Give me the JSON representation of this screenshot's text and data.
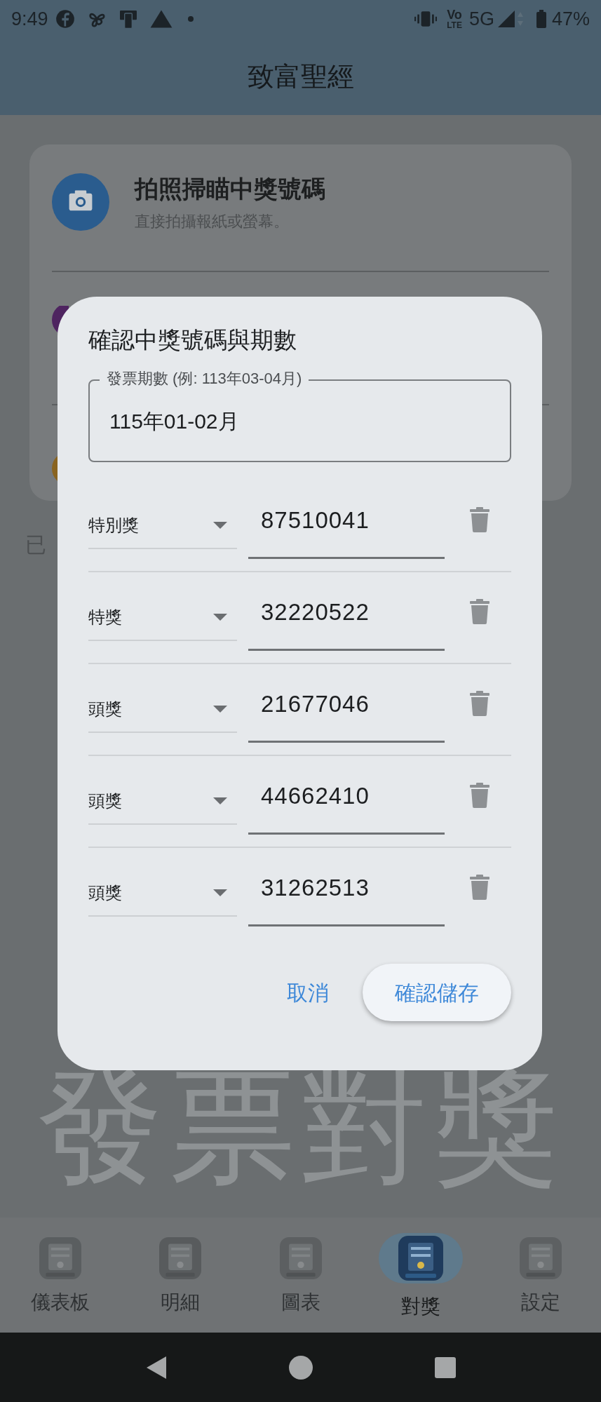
{
  "status_bar": {
    "time": "9:49",
    "volte": [
      "Vo",
      "LTE"
    ],
    "network": "5G",
    "battery": "47%"
  },
  "app_bar": {
    "title": "致富聖經"
  },
  "background": {
    "option": {
      "title": "拍照掃瞄中獎號碼",
      "subtitle": "直接拍攝報紙或螢幕。"
    },
    "partial_label": "已",
    "banner": "發票對獎"
  },
  "dialog": {
    "title": "確認中獎號碼與期數",
    "period_field": {
      "label": "發票期數 (例: 113年03-04月)",
      "value": "115年01-02月"
    },
    "prizes": [
      {
        "type": "特別獎",
        "number": "87510041"
      },
      {
        "type": "特獎",
        "number": "32220522"
      },
      {
        "type": "頭獎",
        "number": "21677046"
      },
      {
        "type": "頭獎",
        "number": "44662410"
      },
      {
        "type": "頭獎",
        "number": "31262513"
      }
    ],
    "buttons": [
      {
        "label": "取消",
        "kind": "text"
      },
      {
        "label": "確認儲存",
        "kind": "filled"
      }
    ]
  },
  "bottom_nav": [
    {
      "label": "儀表板",
      "selected": false
    },
    {
      "label": "明細",
      "selected": false
    },
    {
      "label": "圖表",
      "selected": false
    },
    {
      "label": "對獎",
      "selected": true
    },
    {
      "label": "設定",
      "selected": false
    }
  ]
}
